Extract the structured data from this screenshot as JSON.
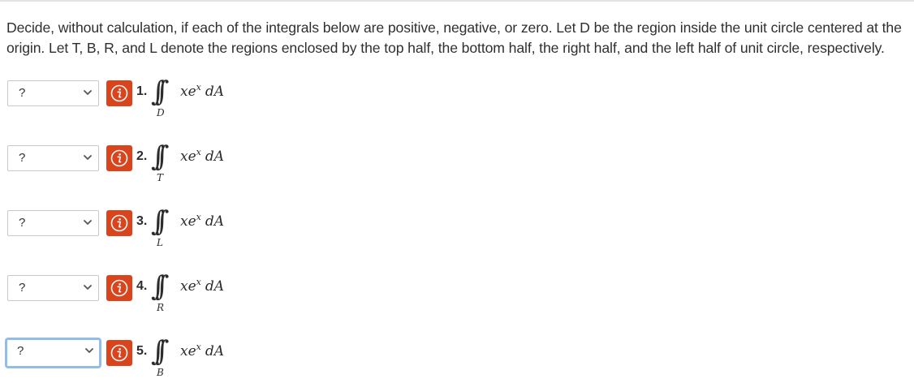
{
  "instructions": "Decide, without calculation, if each of the integrals below are positive, negative, or zero. Let D be the region inside the unit circle centered at the origin. Let T, B, R, and L denote the regions enclosed by the top half, the bottom half, the right half, and the left half of unit circle, respectively.",
  "colors": {
    "info_button": "#d9441c",
    "focus_ring": "#92bde8"
  },
  "questions": [
    {
      "number": "1.",
      "select_value": "?",
      "integrand_base": "xe",
      "integrand_exp": "x",
      "differential": "dA",
      "region": "D",
      "info_icon": "info-icon",
      "focused": false
    },
    {
      "number": "2.",
      "select_value": "?",
      "integrand_base": "xe",
      "integrand_exp": "x",
      "differential": "dA",
      "region": "T",
      "info_icon": "info-icon",
      "focused": false
    },
    {
      "number": "3.",
      "select_value": "?",
      "integrand_base": "xe",
      "integrand_exp": "x",
      "differential": "dA",
      "region": "L",
      "info_icon": "info-icon",
      "focused": false
    },
    {
      "number": "4.",
      "select_value": "?",
      "integrand_base": "xe",
      "integrand_exp": "x",
      "differential": "dA",
      "region": "R",
      "info_icon": "info-icon",
      "focused": false
    },
    {
      "number": "5.",
      "select_value": "?",
      "integrand_base": "xe",
      "integrand_exp": "x",
      "differential": "dA",
      "region": "B",
      "info_icon": "info-icon",
      "focused": true
    }
  ]
}
